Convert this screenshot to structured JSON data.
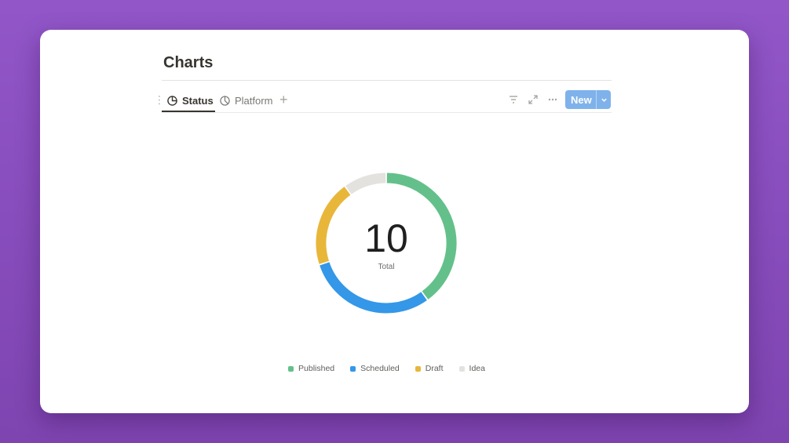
{
  "page": {
    "title": "Charts"
  },
  "tabs": [
    {
      "label": "Status",
      "active": true,
      "icon": "chart-pie-icon"
    },
    {
      "label": "Platform",
      "active": false,
      "icon": "chart-pie-icon"
    }
  ],
  "toolbar": {
    "add_tab_icon": "plus-icon",
    "filter_icon": "filter-icon",
    "expand_icon": "expand-icon",
    "more_icon": "more-icon",
    "new_label": "New",
    "new_caret_icon": "chevron-down-icon",
    "accent": "#7fb2ea"
  },
  "chart_data": {
    "type": "pie",
    "variant": "donut",
    "total": "10",
    "total_label": "Total",
    "categories": [
      "Published",
      "Scheduled",
      "Draft",
      "Idea"
    ],
    "values": [
      4,
      3,
      2,
      1
    ],
    "colors": [
      "#64c08a",
      "#3497e8",
      "#e8b73a",
      "#e3e2df"
    ],
    "legend_position": "bottom"
  }
}
